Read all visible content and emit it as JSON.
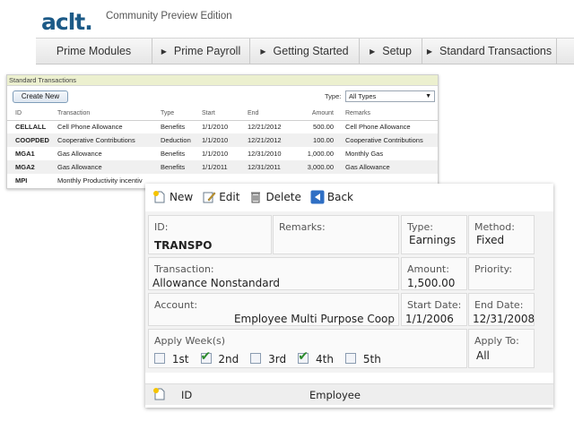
{
  "header": {
    "logo": "aclt.",
    "edition": "Community Preview Edition"
  },
  "nav": {
    "items": [
      {
        "label": "Prime Modules",
        "has_arrow": false
      },
      {
        "label": "Prime Payroll",
        "has_arrow": true
      },
      {
        "label": "Getting Started",
        "has_arrow": true
      },
      {
        "label": "Setup",
        "has_arrow": true
      },
      {
        "label": "Standard Transactions",
        "has_arrow": true
      }
    ]
  },
  "list_window": {
    "title": "Standard Transactions",
    "create_button": "Create New",
    "type_label": "Type:",
    "type_value": "All Types",
    "columns": [
      "ID",
      "Transaction",
      "Type",
      "Start",
      "End",
      "Amount",
      "Remarks"
    ],
    "rows": [
      {
        "id": "CELLALL",
        "transaction": "Cell Phone Allowance",
        "type": "Benefits",
        "start": "1/1/2010",
        "end": "12/21/2012",
        "amount": "500.00",
        "remarks": "Cell Phone Allowance"
      },
      {
        "id": "COOPDED",
        "transaction": "Cooperative Contributions",
        "type": "Deduction",
        "start": "1/1/2010",
        "end": "12/21/2012",
        "amount": "100.00",
        "remarks": "Cooperative Contributions"
      },
      {
        "id": "MGA1",
        "transaction": "Gas Allowance",
        "type": "Benefits",
        "start": "1/1/2010",
        "end": "12/31/2010",
        "amount": "1,000.00",
        "remarks": "Monthly Gas"
      },
      {
        "id": "MGA2",
        "transaction": "Gas Allowance",
        "type": "Benefits",
        "start": "1/1/2011",
        "end": "12/31/2011",
        "amount": "3,000.00",
        "remarks": "Gas Allowance"
      },
      {
        "id": "MPI",
        "transaction": "Monthly Productivity incentiv",
        "type": "",
        "start": "",
        "end": "",
        "amount": "",
        "remarks": ""
      }
    ]
  },
  "detail": {
    "toolbar": {
      "new_label": "New",
      "edit_label": "Edit",
      "delete_label": "Delete",
      "back_label": "Back"
    },
    "fields": {
      "id_label": "ID:",
      "id_value": "TRANSPO",
      "remarks_label": "Remarks:",
      "type_label": "Type:",
      "type_value": "Earnings",
      "method_label": "Method:",
      "method_value": "Fixed",
      "transaction_label": "Transaction:",
      "transaction_value": "Allowance Nonstandard",
      "amount_label": "Amount:",
      "amount_value": "1,500.00",
      "priority_label": "Priority:",
      "account_label": "Account:",
      "account_value": "Employee Multi Purpose Coop",
      "start_label": "Start Date:",
      "start_value": "1/1/2006",
      "end_label": "End Date:",
      "end_value": "12/31/2008",
      "apply_week_label": "Apply Week(s)",
      "weeks": [
        {
          "label": "1st",
          "checked": false
        },
        {
          "label": "2nd",
          "checked": true
        },
        {
          "label": "3rd",
          "checked": false
        },
        {
          "label": "4th",
          "checked": true
        },
        {
          "label": "5th",
          "checked": false
        }
      ],
      "apply_to_label": "Apply To:",
      "apply_to_value": "All"
    },
    "sub_table": {
      "columns": [
        "ID",
        "Employee"
      ]
    }
  },
  "colors": {
    "logo_blue": "#1c5a87",
    "list_title_bg": "#ecf0cf",
    "check_green": "#2a8a2a",
    "back_icon_blue": "#2f6fc4"
  }
}
